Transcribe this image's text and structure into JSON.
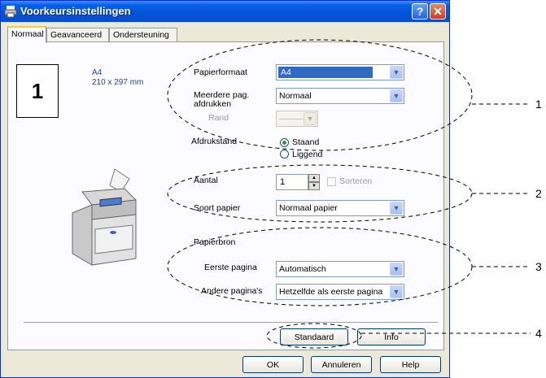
{
  "window": {
    "title": "Voorkeursinstellingen",
    "help_label": "?",
    "close_label": "✕"
  },
  "tabs": [
    {
      "label": "Normaal"
    },
    {
      "label": "Geavanceerd"
    },
    {
      "label": "Ondersteuning"
    }
  ],
  "preview": {
    "page_count": "1",
    "paper_name": "A4",
    "paper_dims": "210 x 297 mm"
  },
  "paper": {
    "format_label": "Papierformaat",
    "format_value": "A4",
    "multi_label_1": "Meerdere pag.",
    "multi_label_2": "afdrukken",
    "multi_value": "Normaal",
    "border_label": "Rand",
    "border_value": "———",
    "orientation_label": "Afdrukstand",
    "portrait_label": "Staand",
    "landscape_label": "Liggend",
    "orientation_selected": "Staand"
  },
  "copies": {
    "label": "Aantal",
    "value": "1",
    "collate_label": "Sorteren"
  },
  "media": {
    "label": "Soort papier",
    "value": "Normaal papier"
  },
  "source": {
    "section_label": "Papierbron",
    "first_label": "Eerste pagina",
    "first_value": "Automatisch",
    "other_label": "Andere pagina's",
    "other_value": "Hetzelfde als eerste pagina"
  },
  "actions": {
    "default_label": "Standaard",
    "info_label": "Info"
  },
  "footer": {
    "ok_label": "OK",
    "cancel_label": "Annuleren",
    "help_label": "Help"
  },
  "callouts": [
    "1",
    "2",
    "3",
    "4"
  ],
  "colors": {
    "title_bar": "#0553d8",
    "selection": "#316ac5",
    "tab_highlight": "#ffc83c",
    "radio_dot": "#21a121"
  }
}
